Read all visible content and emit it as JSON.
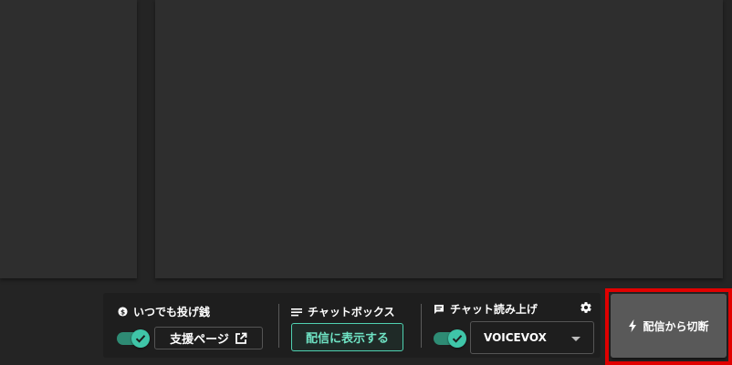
{
  "tip_section": {
    "title": "いつでも投げ銭",
    "title_icon": "coin-icon",
    "support_page_label": "支援ページ",
    "support_page_icon": "open-in-new-icon",
    "toggle_on": true
  },
  "chatbox_section": {
    "title": "チャットボックス",
    "title_icon": "lines-icon",
    "show_in_stream_label": "配信に表示する"
  },
  "tts_section": {
    "title": "チャット読み上げ",
    "title_icon": "chat-bubble-icon",
    "settings_icon": "gear-icon",
    "toggle_on": true,
    "engine_selected": "VOICEVOX"
  },
  "disconnect": {
    "label": "配信から切断",
    "icon": "bolt-icon"
  },
  "colors": {
    "accent": "#3fc5a8",
    "highlight": "#e10000",
    "button_bg": "#595959"
  }
}
